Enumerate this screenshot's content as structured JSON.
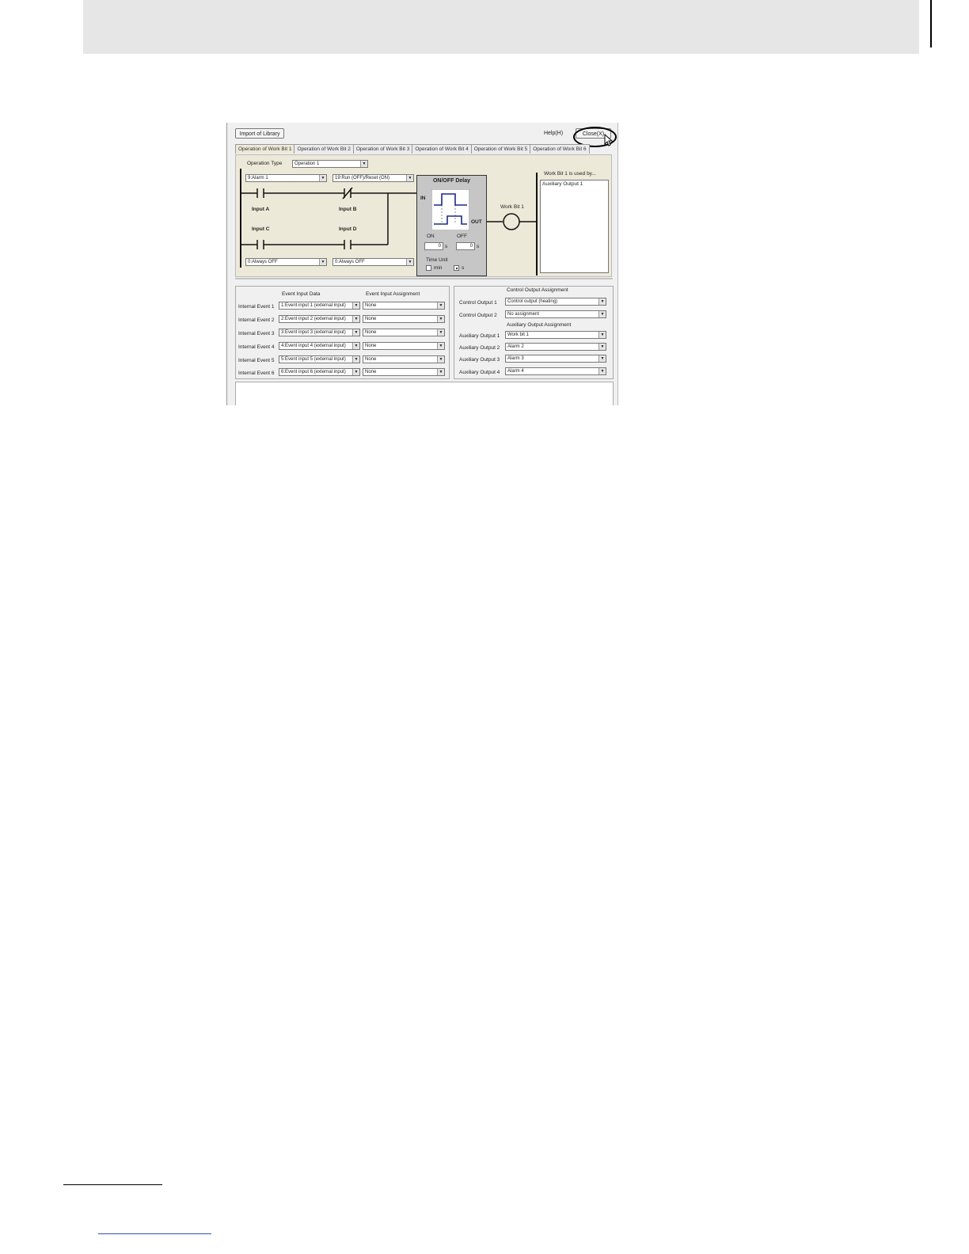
{
  "toolbar": {
    "import_label": "Import of Library",
    "help_label": "Help(H)",
    "close_label": "Close(X)"
  },
  "tabs": [
    {
      "label": "Operation of Work Bit 1"
    },
    {
      "label": "Operation of Work Bit 2"
    },
    {
      "label": "Operation of Work Bit 3"
    },
    {
      "label": "Operation of Work Bit 4"
    },
    {
      "label": "Operation of Work Bit 5"
    },
    {
      "label": "Operation of Work Bit 6"
    }
  ],
  "operation": {
    "type_label": "Operation Type",
    "type_value": "Operation 1"
  },
  "inputs": {
    "a_select": "9:Alarm 1",
    "b_select": "19:Run (OFF)/Reset (ON)",
    "c_select": "0:Always OFF",
    "d_select": "0:Always OFF",
    "a_label": "Input A",
    "b_label": "Input B",
    "c_label": "Input C",
    "d_label": "Input D"
  },
  "delay": {
    "title": "ON/OFF Delay",
    "in_label": "IN",
    "out_label": "OUT",
    "on_label": "ON",
    "off_label": "OFF",
    "on_value": "0",
    "off_value": "0",
    "unit_s": "s",
    "time_unit_label": "Time Unit",
    "unit_min": "min",
    "unit_sec": "s",
    "selected_unit": "s"
  },
  "work_bit": {
    "label": "Work Bit 1",
    "used_by_label": "Work Bit 1 is used by...",
    "used_by": [
      "Auxiliary Output 1"
    ]
  },
  "events": {
    "data_header": "Event Input Data",
    "assign_header": "Event Input Assignment",
    "rows": [
      {
        "label": "Internal Event 1",
        "data": "1:Event input 1 (external input)",
        "assign": "None"
      },
      {
        "label": "Internal Event 2",
        "data": "2:Event input 2 (external input)",
        "assign": "None"
      },
      {
        "label": "Internal Event 3",
        "data": "3:Event input 3 (external input)",
        "assign": "None"
      },
      {
        "label": "Internal Event 4",
        "data": "4:Event input 4 (external input)",
        "assign": "None"
      },
      {
        "label": "Internal Event 5",
        "data": "5:Event input 5 (external input)",
        "assign": "None"
      },
      {
        "label": "Internal Event 6",
        "data": "6:Event input 6 (external input)",
        "assign": "None"
      }
    ]
  },
  "outputs": {
    "control_header": "Control Output Assignment",
    "aux_header": "Auxiliary Output Assignment",
    "control": [
      {
        "label": "Control Output 1",
        "value": "Control output (heating)"
      },
      {
        "label": "Control Output 2",
        "value": "No assignment"
      }
    ],
    "aux": [
      {
        "label": "Auxiliary Output 1",
        "value": "Work bit 1"
      },
      {
        "label": "Auxiliary Output 2",
        "value": "Alarm 2"
      },
      {
        "label": "Auxiliary Output 3",
        "value": "Alarm 3"
      },
      {
        "label": "Auxiliary Output 4",
        "value": "Alarm 4"
      }
    ]
  }
}
